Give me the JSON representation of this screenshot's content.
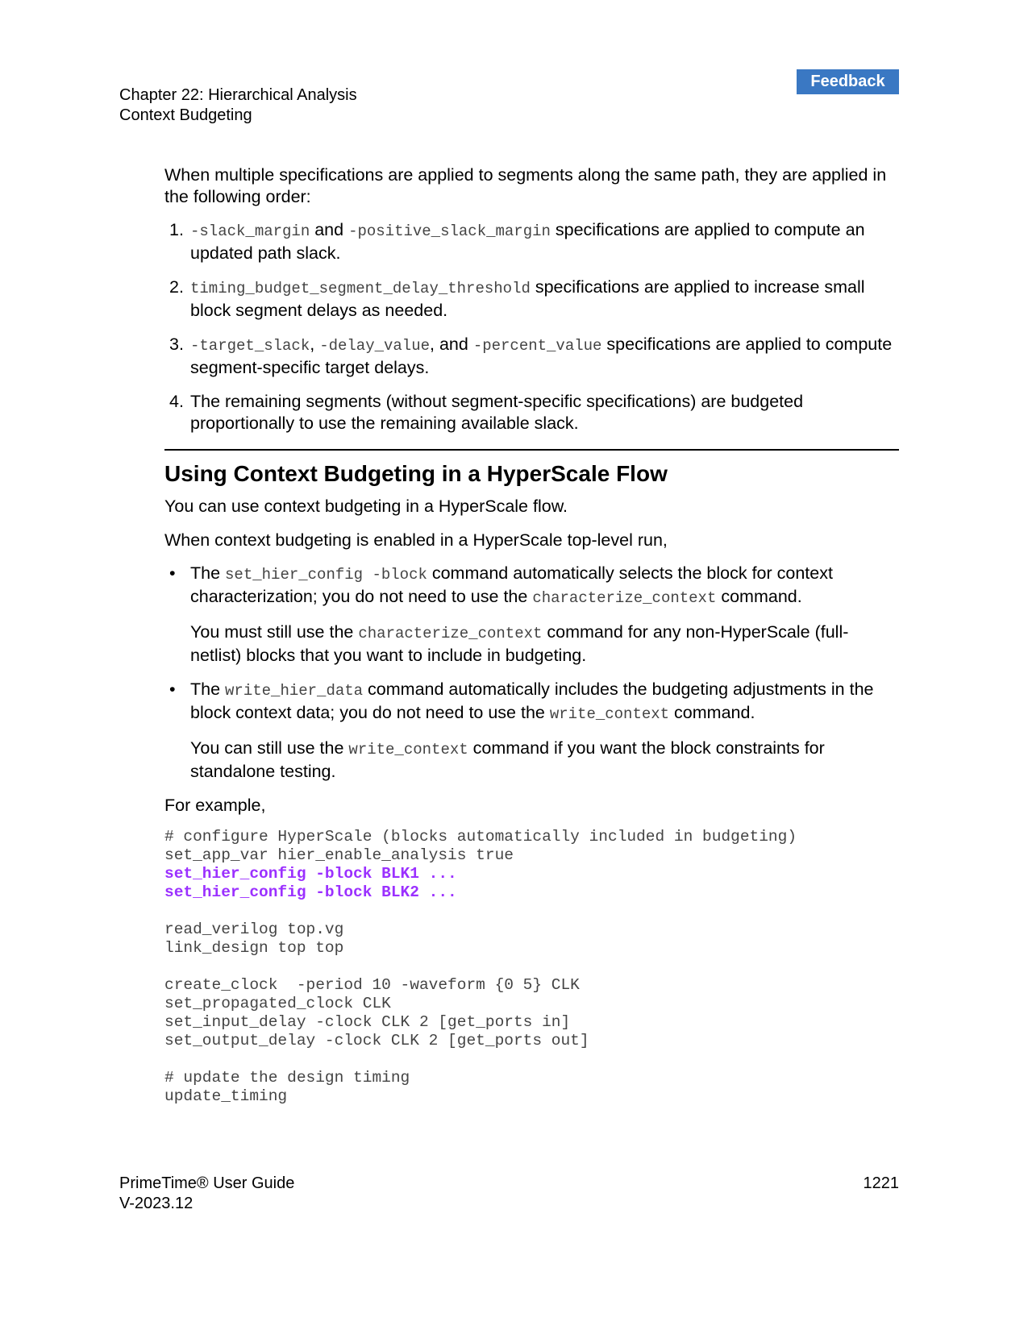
{
  "feedback_label": "Feedback",
  "header": {
    "chapter": "Chapter 22: Hierarchical Analysis",
    "section": "Context Budgeting"
  },
  "intro": "When multiple specifications are applied to segments along the same path, they are applied in the following order:",
  "order_list": [
    {
      "num": "1.",
      "parts": [
        {
          "code": "-slack_margin"
        },
        {
          "text": " and "
        },
        {
          "code": "-positive_slack_margin"
        },
        {
          "text": " specifications are applied to compute an updated path slack."
        }
      ]
    },
    {
      "num": "2.",
      "parts": [
        {
          "code": "timing_budget_segment_delay_threshold"
        },
        {
          "text": " specifications are applied to increase small block segment delays as needed."
        }
      ]
    },
    {
      "num": "3.",
      "parts": [
        {
          "code": "-target_slack"
        },
        {
          "text": ", "
        },
        {
          "code": "-delay_value"
        },
        {
          "text": ", and "
        },
        {
          "code": "-percent_value"
        },
        {
          "text": " specifications are applied to compute segment-specific target delays."
        }
      ]
    },
    {
      "num": "4.",
      "parts": [
        {
          "text": "The remaining segments (without segment-specific specifications) are budgeted proportionally to use the remaining available slack."
        }
      ]
    }
  ],
  "section_title": "Using Context Budgeting in a HyperScale Flow",
  "para1": "You can use context budgeting in a HyperScale flow.",
  "para2": "When context budgeting is enabled in a HyperScale top-level run,",
  "bullets": [
    {
      "bullet": "•",
      "parts": [
        {
          "text": "The "
        },
        {
          "code": "set_hier_config -block"
        },
        {
          "text": " command automatically selects the block for context characterization; you do not need to use the "
        },
        {
          "code": "characterize_context"
        },
        {
          "text": " command."
        }
      ],
      "sub": [
        {
          "text": "You must still use the "
        },
        {
          "code": "characterize_context"
        },
        {
          "text": " command for any non-HyperScale (full-netlist) blocks that you want to include in budgeting."
        }
      ]
    },
    {
      "bullet": "•",
      "parts": [
        {
          "text": "The "
        },
        {
          "code": "write_hier_data"
        },
        {
          "text": " command automatically includes the budgeting adjustments in the block context data; you do not need to use the "
        },
        {
          "code": "write_context"
        },
        {
          "text": " command."
        }
      ],
      "sub": [
        {
          "text": "You can still use the "
        },
        {
          "code": "write_context"
        },
        {
          "text": " command if you want the block constraints for standalone testing."
        }
      ]
    }
  ],
  "example_label": "For example,",
  "code_lines": [
    {
      "text": "# configure HyperScale (blocks automatically included in budgeting)",
      "highlight": false
    },
    {
      "text": "set_app_var hier_enable_analysis true",
      "highlight": false
    },
    {
      "text": "set_hier_config -block BLK1 ...",
      "highlight": true
    },
    {
      "text": "set_hier_config -block BLK2 ...",
      "highlight": true
    },
    {
      "text": "",
      "highlight": false
    },
    {
      "text": "read_verilog top.vg",
      "highlight": false
    },
    {
      "text": "link_design top top",
      "highlight": false
    },
    {
      "text": "",
      "highlight": false
    },
    {
      "text": "create_clock  -period 10 -waveform {0 5} CLK",
      "highlight": false
    },
    {
      "text": "set_propagated_clock CLK",
      "highlight": false
    },
    {
      "text": "set_input_delay -clock CLK 2 [get_ports in]",
      "highlight": false
    },
    {
      "text": "set_output_delay -clock CLK 2 [get_ports out]",
      "highlight": false
    },
    {
      "text": "",
      "highlight": false
    },
    {
      "text": "# update the design timing",
      "highlight": false
    },
    {
      "text": "update_timing",
      "highlight": false
    }
  ],
  "footer": {
    "title": "PrimeTime® User Guide",
    "version": "V-2023.12",
    "page": "1221"
  },
  "colors": {
    "feedback_bg": "#3a78c3",
    "code_highlight": "#9b30ff",
    "code_text": "#444444"
  }
}
